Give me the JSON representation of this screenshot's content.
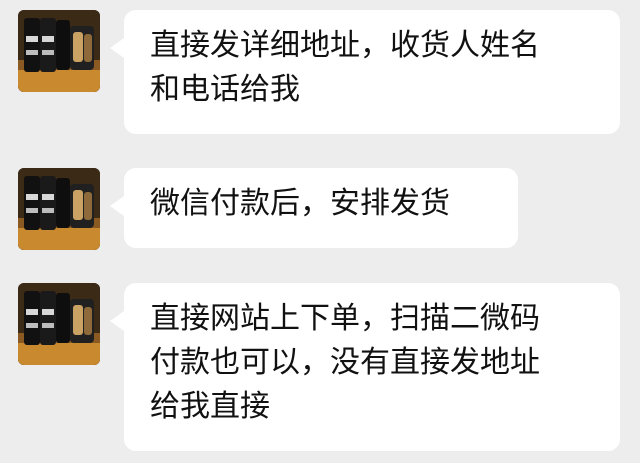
{
  "messages": [
    {
      "sender": "avatar",
      "text": "直接发详细地址，收货人姓名\n和电话给我"
    },
    {
      "sender": "avatar",
      "text": "微信付款后，安排发货"
    },
    {
      "sender": "avatar",
      "text": "直接网站上下单，扫描二微码\n付款也可以，没有直接发地址\n给我直接"
    }
  ],
  "colors": {
    "background": "#ededed",
    "bubble": "#ffffff",
    "text": "#111111"
  }
}
